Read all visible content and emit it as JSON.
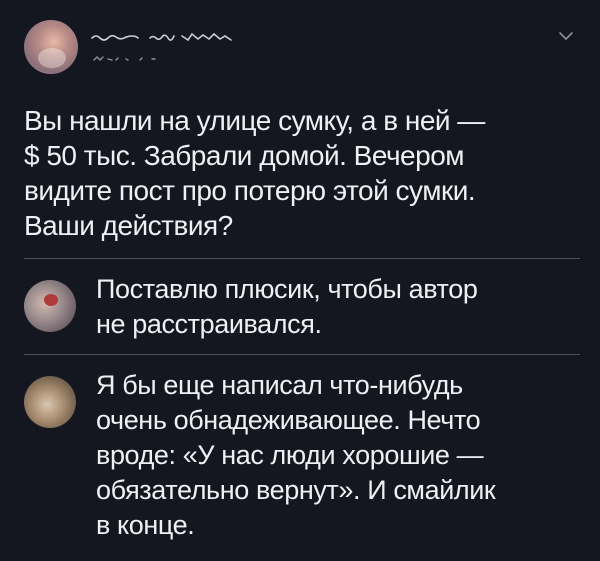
{
  "post": {
    "lines": [
      "Вы нашли на улице сумку, а в ней —",
      "$ 50 тыс. Забрали домой. Вечером",
      "видите пост про потерю этой сумки.",
      "Ваши действия?"
    ]
  },
  "replies": [
    {
      "lines": [
        "Поставлю плюсик, чтобы автор",
        "не расстраивался."
      ]
    },
    {
      "lines": [
        "Я бы еще написал что-нибудь",
        "очень обнадеживающее. Нечто",
        "вроде: «У нас люди хорошие —",
        "обязательно вернут». И смайлик",
        "в конце."
      ]
    }
  ],
  "icons": {
    "more": "chevron-down-icon"
  },
  "colors": {
    "background": "#14171f",
    "text": "#eef0f4",
    "divider": "#4a4f5a"
  }
}
